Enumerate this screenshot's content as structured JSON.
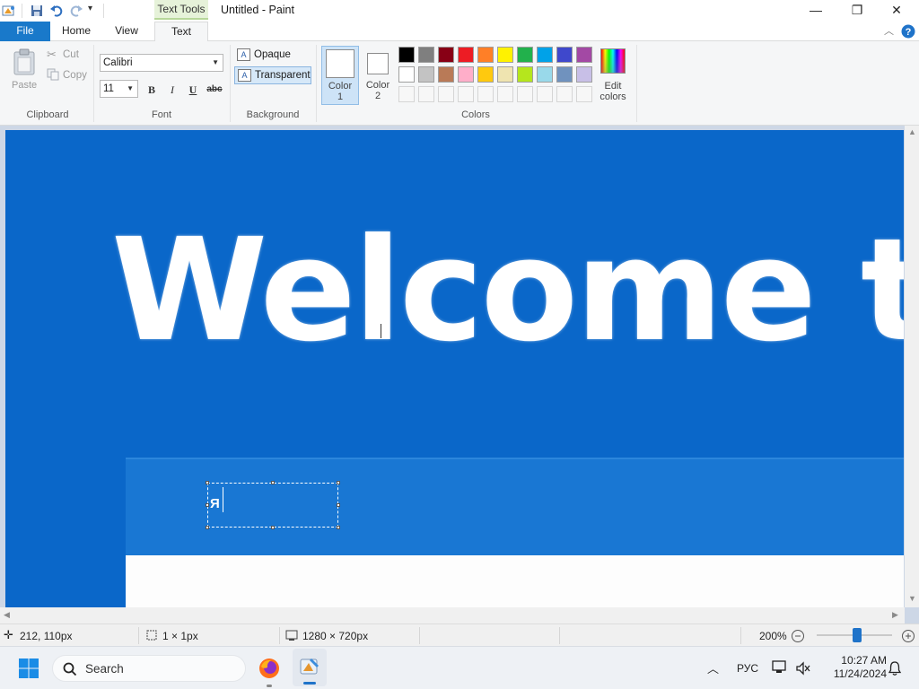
{
  "titlebar": {
    "context_tab": "Text Tools",
    "window_title": "Untitled - Paint",
    "minimize_glyph": "—",
    "maximize_glyph": "❐",
    "close_glyph": "✕"
  },
  "tabs": {
    "file": "File",
    "home": "Home",
    "view": "View",
    "text": "Text"
  },
  "ribbon": {
    "clipboard": {
      "paste": "Paste",
      "cut": "Cut",
      "copy": "Copy",
      "label": "Clipboard"
    },
    "font": {
      "family": "Calibri",
      "size": "11",
      "bold": "B",
      "italic": "I",
      "underline": "U",
      "strike": "abc",
      "label": "Font"
    },
    "background": {
      "opaque": "Opaque",
      "transparent": "Transparent",
      "label": "Background"
    },
    "colors": {
      "color1_line1": "Color",
      "color1_line2": "1",
      "color2_line1": "Color",
      "color2_line2": "2",
      "edit_line1": "Edit",
      "edit_line2": "colors",
      "label": "Colors",
      "color1_value": "#ffffff",
      "color2_value": "#ffffff",
      "palette_row1": [
        "#000000",
        "#7f7f7f",
        "#880015",
        "#ed1c24",
        "#ff7f27",
        "#fff200",
        "#22b14c",
        "#00a2e8",
        "#3f48cc",
        "#a349a4"
      ],
      "palette_row2": [
        "#ffffff",
        "#c3c3c3",
        "#b97a57",
        "#ffaec9",
        "#ffc90e",
        "#efe4b0",
        "#b5e61d",
        "#99d9ea",
        "#7092be",
        "#c8bfe7"
      ]
    }
  },
  "canvas": {
    "headline": "Welcome to",
    "typed_text": "Я",
    "background_color": "#0a67c9"
  },
  "status": {
    "cursor_pos": "212, 110px",
    "selection_size": "1 × 1px",
    "image_size": "1280 × 720px",
    "zoom": "200%"
  },
  "taskbar": {
    "search_placeholder": "Search",
    "language": "РУС",
    "time": "10:27 AM",
    "date": "11/24/2024"
  }
}
